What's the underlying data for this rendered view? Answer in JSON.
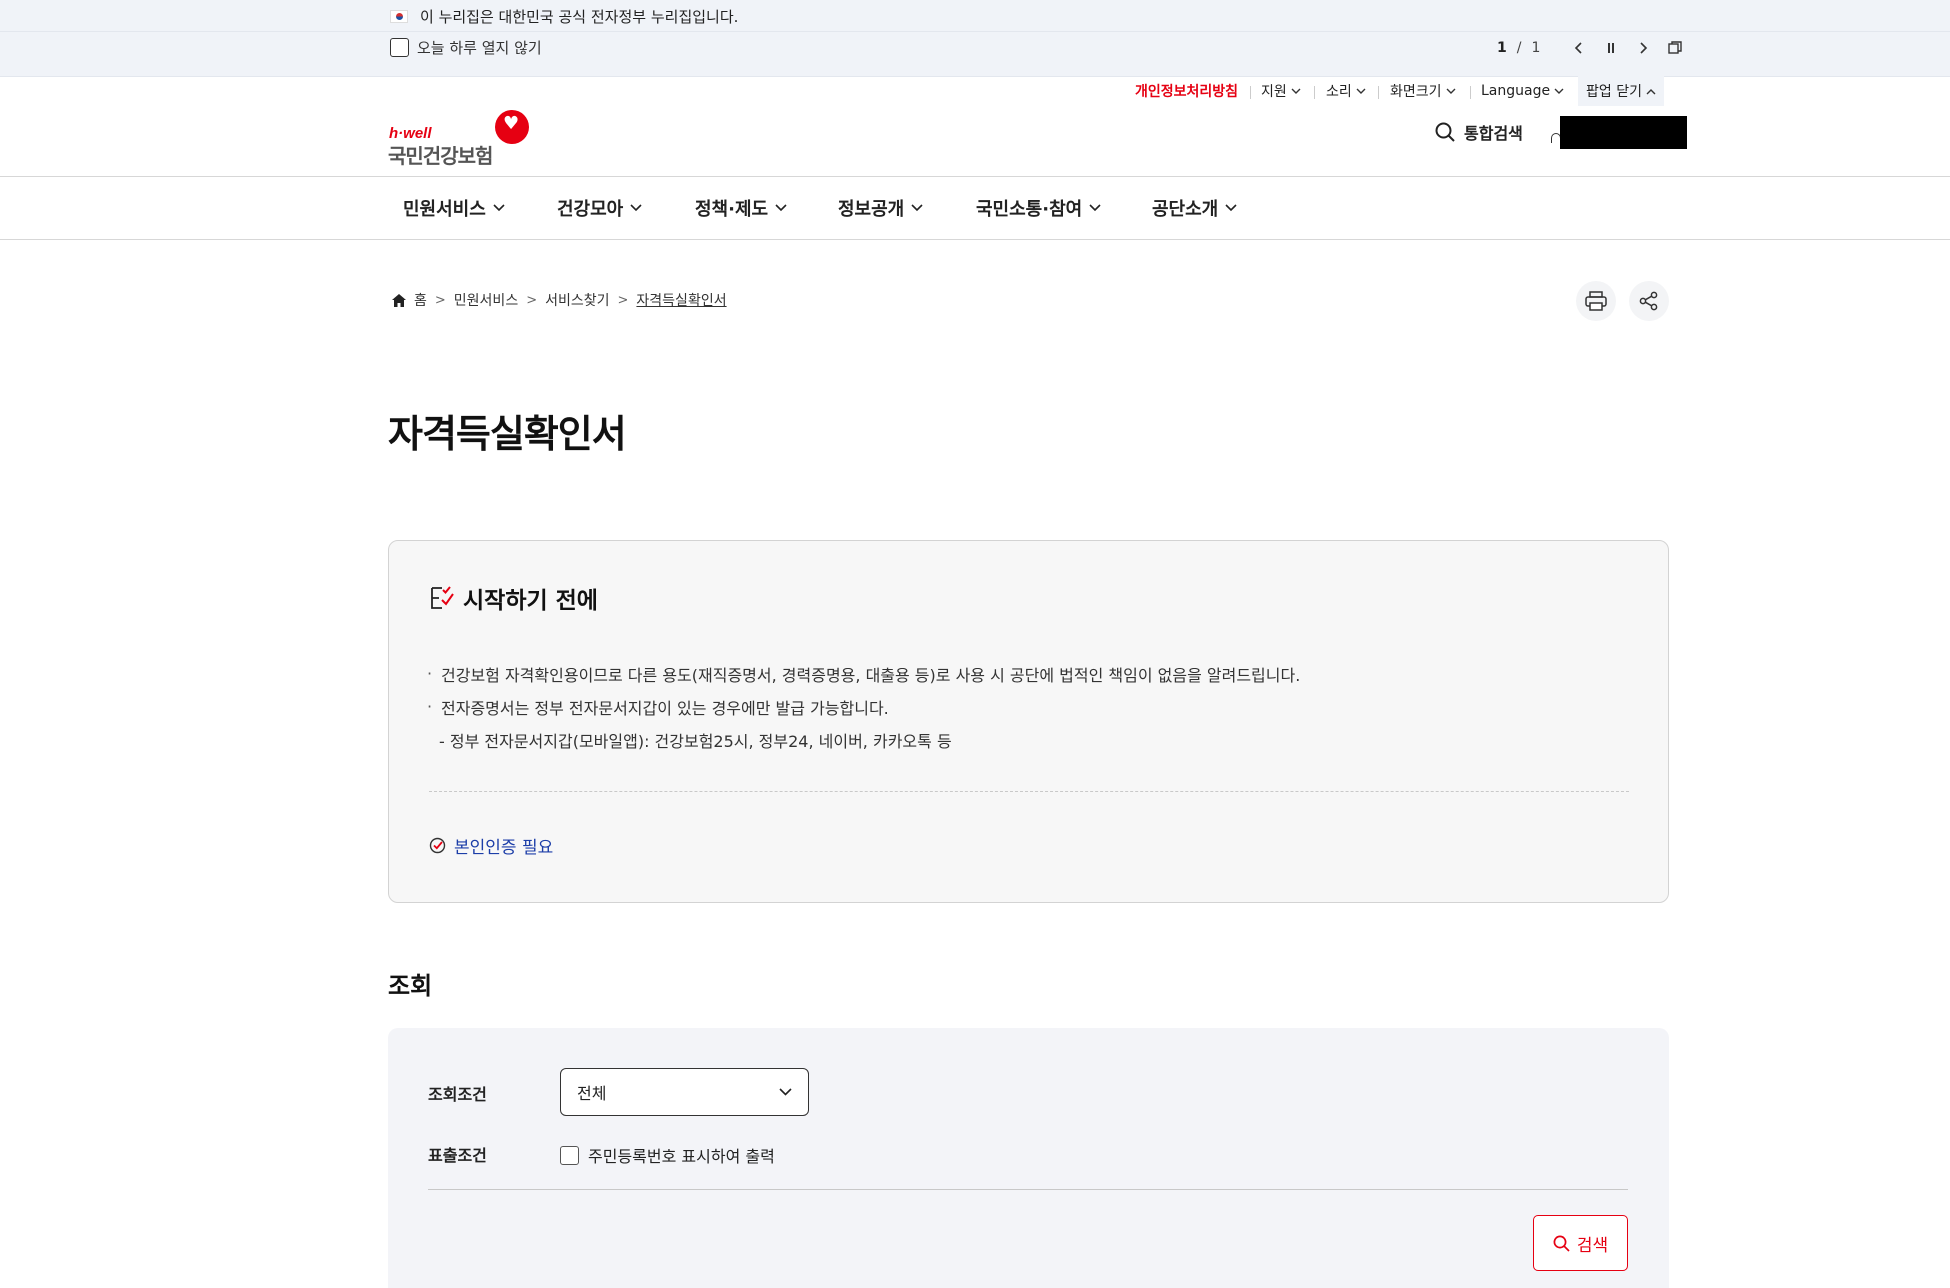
{
  "gov_banner": {
    "text": "이 누리집은 대한민국 공식 전자정부 누리집입니다."
  },
  "popup_bar": {
    "dont_show_today": "오늘 하루 열지 않기",
    "current_page": "1",
    "separator": "/",
    "total_pages": "1"
  },
  "utility_nav": {
    "privacy": "개인정보처리방침",
    "support": "지원",
    "sound": "소리",
    "screen_size": "화면크기",
    "language": "Language",
    "close_popup": "팝업 닫기"
  },
  "header": {
    "logo_tagline": "h·well",
    "logo_name": "국민건강보험",
    "search_label": "통합검색"
  },
  "gnb": {
    "items": [
      "민원서비스",
      "건강모아",
      "정책·제도",
      "정보공개",
      "국민소통·참여",
      "공단소개"
    ]
  },
  "breadcrumb": {
    "home": "홈",
    "items": [
      "민원서비스",
      "서비스찾기",
      "자격득실확인서"
    ]
  },
  "page_title": "자격득실확인서",
  "before_start": {
    "title": "시작하기 전에",
    "items": [
      "건강보험 자격확인용이므로 다른 용도(재직증명서, 경력증명용, 대출용 등)로 사용 시 공단에 법적인 책임이 없음을 알려드립니다.",
      "전자증명서는 정부 전자문서지갑이 있는 경우에만 발급 가능합니다."
    ],
    "sub_item": "- 정부 전자문서지갑(모바일앱): 건강보험25시, 정부24, 네이버, 카카오톡 등",
    "auth_required": "본인인증 필요"
  },
  "inquiry": {
    "section_title": "조회",
    "condition_label": "조회조건",
    "condition_value": "전체",
    "output_label": "표출조건",
    "output_option": "주민등록번호 표시하여 출력",
    "search_button": "검색"
  },
  "colors": {
    "brand_red": "#e60012",
    "link_blue": "#1c3ea8",
    "banner_bg": "#f0f3f8"
  }
}
